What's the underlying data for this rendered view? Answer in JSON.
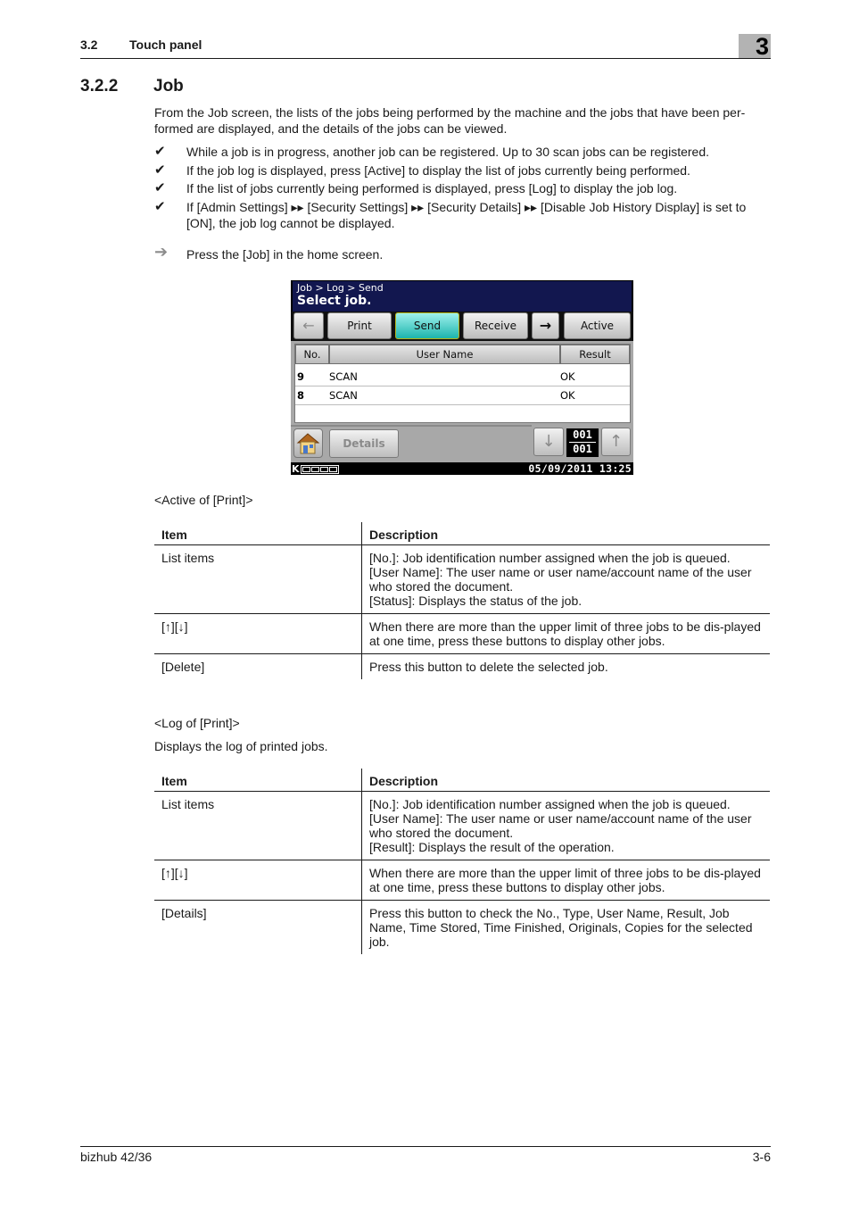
{
  "header": {
    "section_number": "3.2",
    "section_title": "Touch panel",
    "chapter": "3"
  },
  "section": {
    "number": "3.2.2",
    "title": "Job"
  },
  "intro": "From the Job screen, the lists of the jobs being performed by the machine and the jobs that have been per-formed are displayed, and the details of the jobs can be viewed.",
  "bullets": [
    "While a job is in progress, another job can be registered. Up to 30 scan jobs can be registered.",
    "If the job log is displayed, press [Active] to display the list of jobs currently being performed.",
    "If the list of jobs currently being performed is displayed, press [Log] to display the job log.",
    "If [Admin Settings] ▸▸ [Security Settings] ▸▸ [Security Details] ▸▸ [Disable Job History Display] is set to [ON], the job log cannot be displayed."
  ],
  "bullet_icon": "✔",
  "step": {
    "icon": "➔",
    "text": "Press the [Job] in the home screen."
  },
  "panel": {
    "breadcrumb": "Job > Log > Send",
    "heading": "Select job.",
    "tabs": {
      "prev": "←",
      "print": "Print",
      "send": "Send",
      "receive": "Receive",
      "next": "→",
      "active": "Active"
    },
    "selected_tab": "Send",
    "columns": [
      "No.",
      "User Name",
      "Result"
    ],
    "rows": [
      {
        "no": "9",
        "user": "SCAN",
        "result": "OK"
      },
      {
        "no": "8",
        "user": "SCAN",
        "result": "OK"
      }
    ],
    "details_label": "Details",
    "down_icon": "↓",
    "up_icon": "↑",
    "page_current": "001",
    "page_total": "001",
    "toner_label": "K",
    "datetime": "05/09/2011  13:25"
  },
  "table_active": {
    "caption": "<Active of [Print]>",
    "headers": [
      "Item",
      "Description"
    ],
    "rows": [
      {
        "item": "List items",
        "desc": [
          "[No.]: Job identification number assigned when the job is queued.",
          "[User Name]: The user name or user name/account name of the user who stored the document.",
          "[Status]: Displays the status of the job."
        ]
      },
      {
        "item": "[↑][↓]",
        "desc": [
          "When there are more than the upper limit of three jobs to be dis-played at one time, press these buttons to display other jobs."
        ]
      },
      {
        "item": "[Delete]",
        "desc": [
          "Press this button to delete the selected job."
        ]
      }
    ]
  },
  "table_log": {
    "caption": "<Log of [Print]>",
    "intro": "Displays the log of printed jobs.",
    "headers": [
      "Item",
      "Description"
    ],
    "rows": [
      {
        "item": "List items",
        "desc": [
          "[No.]: Job identification number assigned when the job is queued.",
          "[User Name]: The user name or user name/account name of the user who stored the document.",
          "[Result]: Displays the result of the operation."
        ]
      },
      {
        "item": "[↑][↓]",
        "desc": [
          "When there are more than the upper limit of three jobs to be dis-played at one time, press these buttons to display other jobs."
        ]
      },
      {
        "item": "[Details]",
        "desc": [
          "Press this button to check the No., Type, User Name, Result, Job Name, Time Stored, Time Finished, Originals, Copies for the selected job."
        ]
      }
    ]
  },
  "footer": {
    "product": "bizhub 42/36",
    "page": "3-6"
  }
}
